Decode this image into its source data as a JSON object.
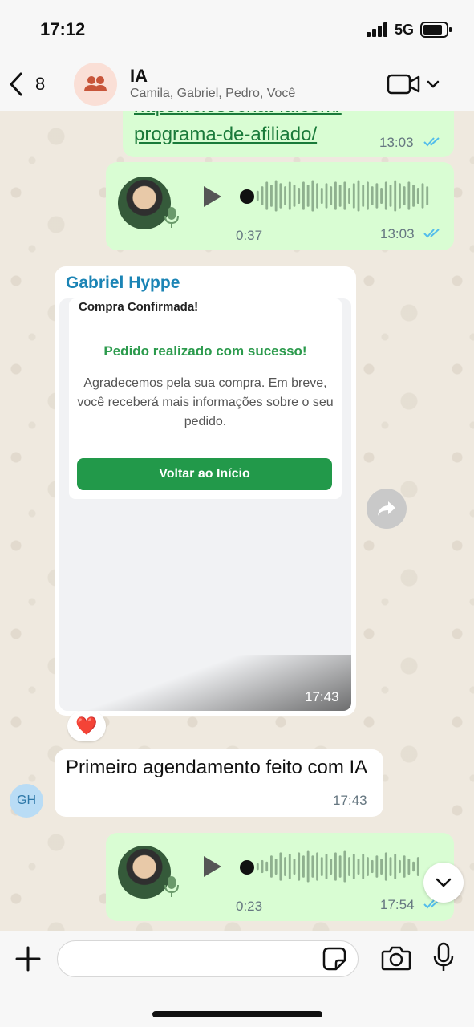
{
  "status_bar": {
    "time": "17:12",
    "network": "5G"
  },
  "header": {
    "back_count": "8",
    "title": "IA",
    "members": "Camila, Gabriel, Pedro, Você"
  },
  "messages": {
    "link_message": {
      "line1": "https://closechat-ia.com/",
      "line2": "programa-de-afiliado/",
      "time": "13:03"
    },
    "voice1": {
      "duration": "0:37",
      "time": "13:03"
    },
    "gabriel_image": {
      "sender": "Gabriel Hyppe",
      "card_title": "Compra Confirmada!",
      "success_title": "Pedido realizado com sucesso!",
      "success_text": "Agradecemos pela sua compra. Em breve, você receberá mais informações sobre o seu pedido.",
      "button_label": "Voltar ao Início",
      "time": "17:43",
      "reaction": "❤️"
    },
    "text_message": {
      "avatar_initials": "GH",
      "text": "Primeiro agendamento feito com IA",
      "time": "17:43"
    },
    "voice2": {
      "duration": "0:23",
      "time": "17:54"
    }
  },
  "input": {
    "placeholder": ""
  },
  "colors": {
    "outgoing_bubble": "#d9fdd3",
    "incoming_bubble": "#ffffff",
    "sender_name": "#1b84b5",
    "read_ticks": "#53bdeb",
    "success_green": "#22994a"
  }
}
